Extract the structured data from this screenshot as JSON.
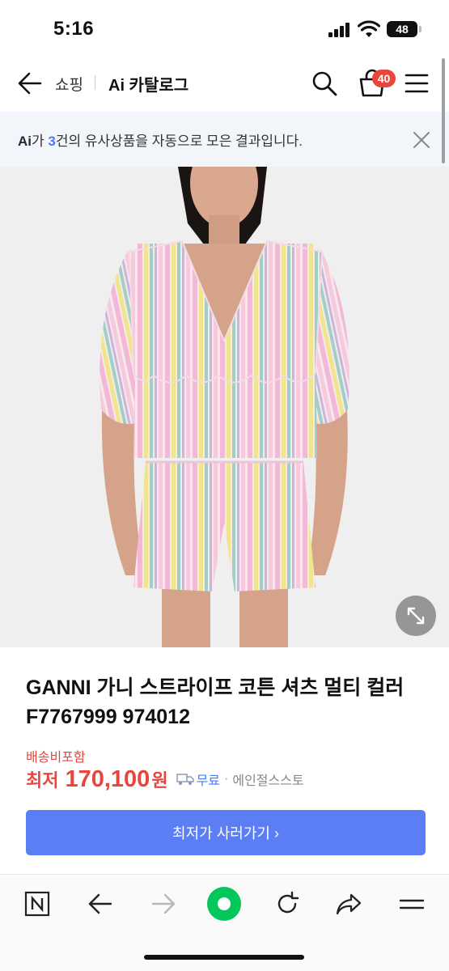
{
  "status_bar": {
    "time": "5:16",
    "battery": "48"
  },
  "header": {
    "shop_label": "쇼핑",
    "catalog_label": "Ai 카탈로그",
    "cart_count": "40",
    "icons": [
      "back-arrow-icon",
      "search-icon",
      "cart-icon",
      "menu-icon"
    ]
  },
  "ai_banner": {
    "ai_mark": "Ai",
    "text_before": "가 ",
    "count": "3",
    "text_after": "건의 유사상품을 자동으로 모은 결과입니다."
  },
  "product": {
    "title": "GANNI 가니 스트라이프 코튼 셔츠 멀티 컬러 F7767999 974012",
    "shipping_label": "배송비포함",
    "price_prefix": "최저",
    "price_value": "170,100",
    "price_unit": "원",
    "free_shipping": "무료",
    "dot": "·",
    "seller": "에인절스스토"
  },
  "cta": {
    "label": "최저가 사러가기 ›"
  },
  "colors": {
    "accent_blue": "#5b7ef5",
    "price_red": "#e8453c",
    "banner_bg": "#f2f5fa",
    "naver_green": "#03c75a"
  },
  "toolbar": {
    "icons": [
      "naver-home-icon",
      "back-icon",
      "forward-icon",
      "green-dot-icon",
      "refresh-icon",
      "share-icon",
      "menu-icon"
    ]
  }
}
